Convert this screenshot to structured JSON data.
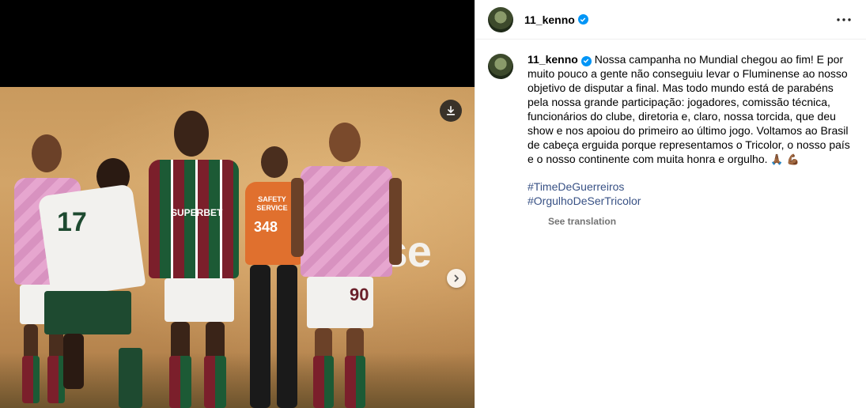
{
  "post": {
    "username": "11_kenno",
    "verified": true,
    "caption": "Nossa campanha no Mundial chegou ao fim! E por muito pouco a gente não conseguiu levar o Fluminense ao nosso objetivo de disputar a final. Mas todo mundo está de parabéns pela nossa grande participação: jogadores, comissão técnica, funcionários do clube, diretoria e, claro, nossa torcida, que deu show e nos apoiou do primeiro ao último jogo. Voltamos ao Brasil de cabeça erguida porque representamos o Tricolor, o nosso país e o nosso continente com muita honra e orgulho.",
    "caption_emojis": [
      "🙏🏾",
      "💪🏾"
    ],
    "hashtags": [
      "#TimeDeGuerreiros",
      "#OrgulhoDeSerTricolor"
    ],
    "see_translation": "See translation"
  },
  "photo": {
    "sponsor_fragment": "ise",
    "jersey_sponsor": "SUPERBET",
    "bib_number": "90",
    "away_number": "17",
    "vest_text": "SAFETY SERVICE",
    "vest_number": "348"
  },
  "icons": {
    "download": "download-icon",
    "next": "chevron-right-icon",
    "more": "more-horizontal-icon",
    "verified": "verified-badge-icon"
  },
  "colors": {
    "verified_blue": "#0095f6",
    "hashtag_blue": "#385185",
    "muted_gray": "#737373"
  }
}
